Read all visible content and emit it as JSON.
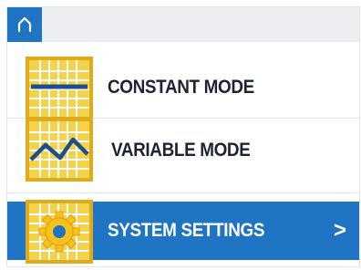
{
  "header": {
    "home_icon": "home-icon"
  },
  "menu": {
    "items": [
      {
        "label": "CONSTANT MODE",
        "icon": "constant-mode-icon",
        "selected": false
      },
      {
        "label": "VARIABLE MODE",
        "icon": "variable-mode-icon",
        "selected": false
      },
      {
        "label": "SYSTEM SETTINGS",
        "icon": "gear-icon",
        "selected": true,
        "chevron": ">"
      }
    ]
  },
  "colors": {
    "accent": "#1f74c4",
    "icon_fill": "#f4d24a",
    "icon_border": "#ddab1b",
    "text": "#1d2333",
    "topbar": "#eceef1"
  }
}
